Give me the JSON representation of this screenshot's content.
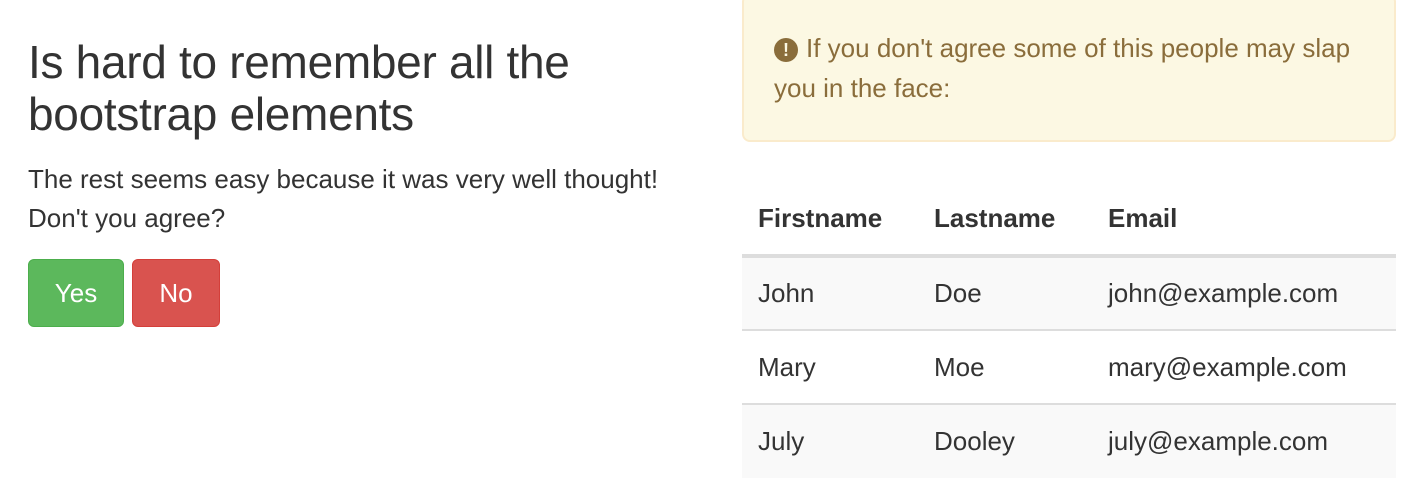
{
  "left": {
    "heading": "Is hard to remember all the bootstrap elements",
    "text": "The rest seems easy because it was very well thought! Don't you agree?",
    "buttons": {
      "yes_label": "Yes",
      "no_label": "No"
    }
  },
  "alert": {
    "icon": "exclamation-circle-icon",
    "icon_glyph": "!",
    "text": "If you don't agree some of this people may slap you in the face:"
  },
  "table": {
    "headers": [
      "Firstname",
      "Lastname",
      "Email"
    ],
    "rows": [
      [
        "John",
        "Doe",
        "john@example.com"
      ],
      [
        "Mary",
        "Moe",
        "mary@example.com"
      ],
      [
        "July",
        "Dooley",
        "july@example.com"
      ]
    ]
  },
  "colors": {
    "success": "#5cb85c",
    "danger": "#d9534f",
    "warning_bg": "#fcf8e3",
    "warning_text": "#8a6d3b"
  }
}
